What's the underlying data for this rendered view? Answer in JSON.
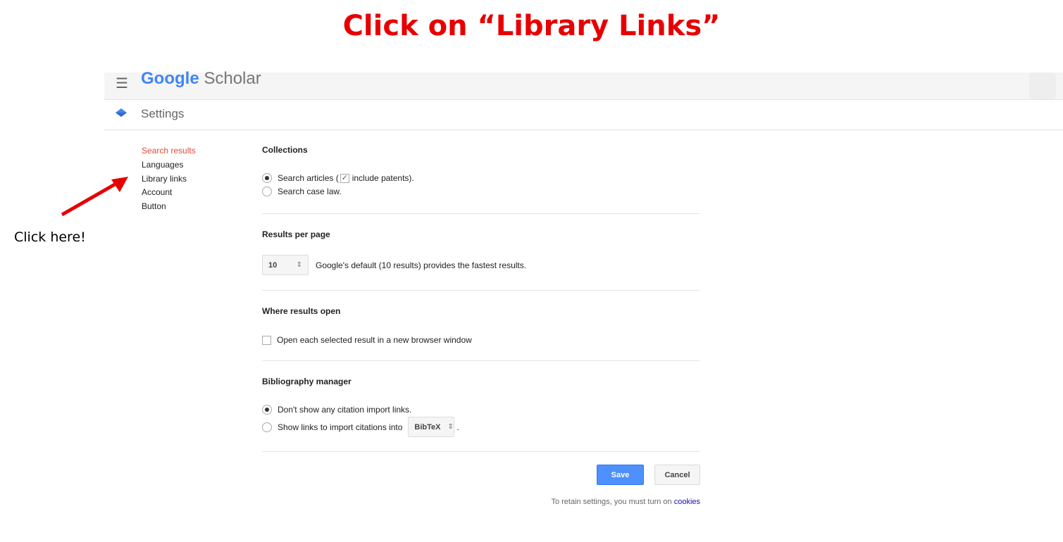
{
  "banner": {
    "title": "Click on “Library Links”"
  },
  "annotation": {
    "label": "Click here!"
  },
  "topbar": {
    "logo_google": "Google",
    "logo_product": "Scholar"
  },
  "settings_bar": {
    "title": "Settings"
  },
  "sidenav": {
    "items": [
      {
        "label": "Search results",
        "active": true
      },
      {
        "label": "Languages"
      },
      {
        "label": "Library links"
      },
      {
        "label": "Account"
      },
      {
        "label": "Button"
      }
    ]
  },
  "collections": {
    "heading": "Collections",
    "search_articles_pre": "Search articles (",
    "include_patents": "include patents).",
    "search_case_law": "Search case law."
  },
  "results_per_page": {
    "heading": "Results per page",
    "value": "10",
    "description": "Google's default (10 results) provides the fastest results."
  },
  "where_results_open": {
    "heading": "Where results open",
    "option": "Open each selected result in a new browser window"
  },
  "bibliography": {
    "heading": "Bibliography manager",
    "option_none": "Don't show any citation import links.",
    "option_show": "Show links to import citations into",
    "format": "BibTeX",
    "trailing": "."
  },
  "actions": {
    "save": "Save",
    "cancel": "Cancel"
  },
  "footer": {
    "text": "To retain settings, you must turn on",
    "link": "cookies"
  },
  "colors": {
    "banner": "#e80000",
    "active_nav": "#dd4b39",
    "save_button": "#4d90fe",
    "arrow": "#e80000"
  }
}
